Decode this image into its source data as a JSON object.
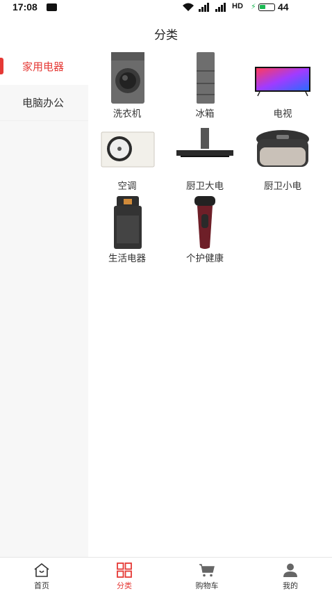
{
  "status_bar": {
    "time": "17:08",
    "network": "HD",
    "battery": "44"
  },
  "header": {
    "title": "分类"
  },
  "sidebar": {
    "items": [
      {
        "label": "家用电器",
        "active": true
      },
      {
        "label": "电脑办公",
        "active": false
      }
    ]
  },
  "categories": [
    {
      "label": "洗衣机",
      "icon": "washing-machine-icon"
    },
    {
      "label": "冰箱",
      "icon": "refrigerator-icon"
    },
    {
      "label": "电视",
      "icon": "tv-icon"
    },
    {
      "label": "空调",
      "icon": "air-conditioner-icon"
    },
    {
      "label": "厨卫大电",
      "icon": "range-hood-icon"
    },
    {
      "label": "厨卫小电",
      "icon": "rice-cooker-icon"
    },
    {
      "label": "生活电器",
      "icon": "water-dispenser-icon"
    },
    {
      "label": "个护健康",
      "icon": "shaver-icon"
    }
  ],
  "tabbar": {
    "items": [
      {
        "label": "首页",
        "icon": "home-icon",
        "active": false
      },
      {
        "label": "分类",
        "icon": "category-icon",
        "active": true
      },
      {
        "label": "购物车",
        "icon": "cart-icon",
        "active": false
      },
      {
        "label": "我的",
        "icon": "user-icon",
        "active": false
      }
    ]
  },
  "colors": {
    "accent": "#e53935",
    "sidebar_bg": "#f7f7f7",
    "text": "#333333"
  }
}
